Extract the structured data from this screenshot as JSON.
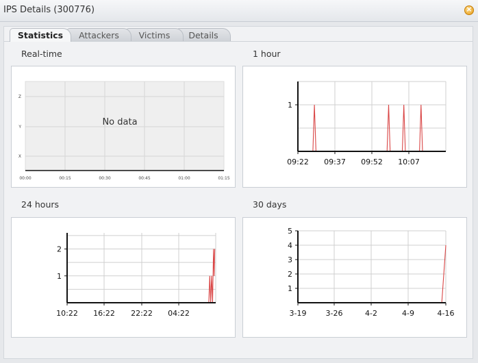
{
  "window": {
    "title": "IPS Details (300776)"
  },
  "tabs": [
    {
      "label": "Statistics",
      "active": true
    },
    {
      "label": "Attackers",
      "active": false
    },
    {
      "label": "Victims",
      "active": false
    },
    {
      "label": "Details",
      "active": false
    }
  ],
  "sections": {
    "realtime": "Real-time",
    "hour": "1 hour",
    "day": "24 hours",
    "month": "30 days"
  },
  "colors": {
    "series": "#d94545",
    "grid": "#cfcfcf",
    "axis": "#111111",
    "plot_bg_empty": "#efefef"
  },
  "chart_data": [
    {
      "id": "realtime",
      "type": "line",
      "title": "Real-time",
      "message": "No data",
      "x_ticks": [
        "00:00",
        "00:15",
        "00:30",
        "00:45",
        "01:00",
        "01:15"
      ],
      "y_ticks": [
        "X",
        "Y",
        "Z"
      ],
      "series": []
    },
    {
      "id": "hour",
      "type": "line",
      "title": "1 hour",
      "x_ticks": [
        "09:22",
        "09:37",
        "09:52",
        "10:07"
      ],
      "y_ticks": [
        1
      ],
      "ylim": [
        0,
        1.5
      ],
      "xlim": [
        0,
        68
      ],
      "series": [
        {
          "x": [
            0,
            6.9,
            7.6,
            8.3,
            41,
            41.7,
            42.4,
            48,
            48.7,
            49.4,
            55.9,
            56.6,
            57.3,
            68
          ],
          "y": [
            0,
            0,
            1,
            0,
            0,
            1,
            0,
            0,
            1,
            0,
            0,
            1,
            0,
            0
          ]
        }
      ]
    },
    {
      "id": "day",
      "type": "line",
      "title": "24 hours",
      "x_ticks": [
        "10:22",
        "16:22",
        "22:22",
        "04:22"
      ],
      "y_ticks": [
        1,
        2
      ],
      "ylim": [
        0,
        2.6
      ],
      "xlim": [
        0,
        23.6
      ],
      "series": [
        {
          "x": [
            0,
            22.5,
            22.65,
            22.8,
            22.95,
            23.1,
            23.25,
            23.35,
            23.45
          ],
          "y": [
            0,
            0,
            1,
            0,
            1,
            0,
            2,
            1,
            2
          ]
        }
      ]
    },
    {
      "id": "month",
      "type": "line",
      "title": "30 days",
      "x_ticks": [
        "3-19",
        "3-26",
        "4-2",
        "4-9",
        "4-16"
      ],
      "y_ticks": [
        1,
        2,
        3,
        4,
        5
      ],
      "ylim": [
        0,
        5
      ],
      "xlim": [
        0,
        29.4
      ],
      "series": [
        {
          "x": [
            0,
            28.6,
            29.4
          ],
          "y": [
            0,
            0,
            4
          ]
        }
      ]
    }
  ]
}
